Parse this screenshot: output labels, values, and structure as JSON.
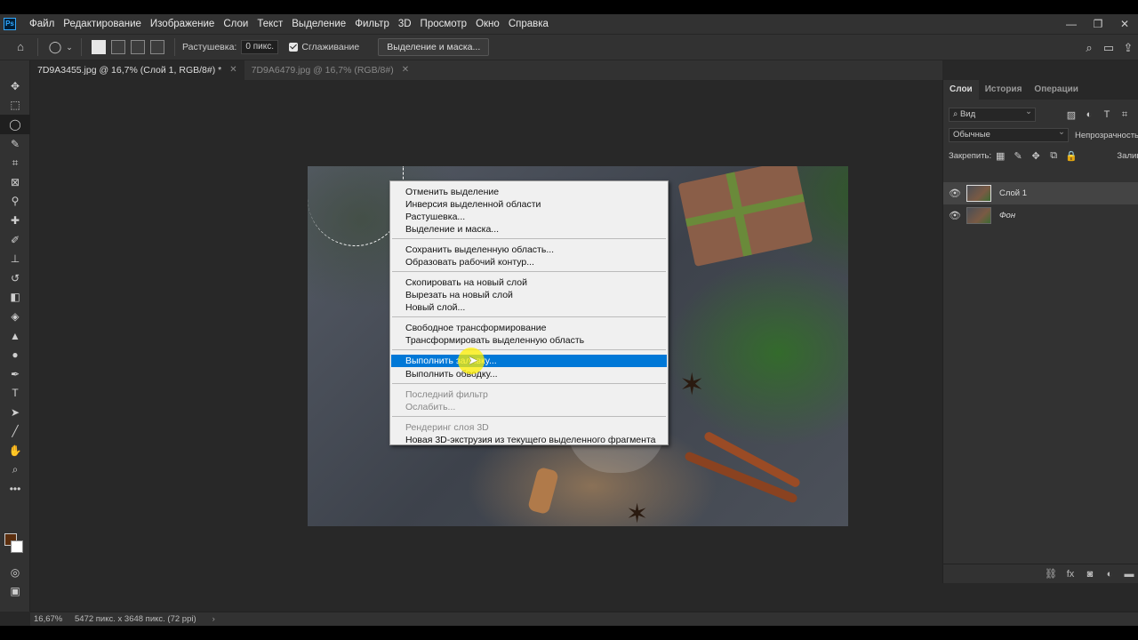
{
  "app": {
    "logo": "Ps"
  },
  "menu": [
    "Файл",
    "Редактирование",
    "Изображение",
    "Слои",
    "Текст",
    "Выделение",
    "Фильтр",
    "3D",
    "Просмотр",
    "Окно",
    "Справка"
  ],
  "window_controls": {
    "minimize": "—",
    "restore": "❐",
    "close": "✕"
  },
  "options": {
    "feather_label": "Растушевка:",
    "feather_value": "0 пикс.",
    "antialias_label": "Сглаживание",
    "select_mask_label": "Выделение и маска..."
  },
  "tabs": [
    {
      "label": "7D9A3455.jpg @ 16,7% (Слой 1, RGB/8#) *",
      "active": true
    },
    {
      "label": "7D9A6479.jpg @ 16,7% (RGB/8#)",
      "active": false
    }
  ],
  "context_menu": {
    "items": [
      {
        "label": "Отменить выделение",
        "state": "normal"
      },
      {
        "label": "Инверсия выделенной области",
        "state": "normal"
      },
      {
        "label": "Растушевка...",
        "state": "normal"
      },
      {
        "label": "Выделение и маска...",
        "state": "normal"
      },
      {
        "label": "Сохранить выделенную область...",
        "state": "normal"
      },
      {
        "label": "Образовать рабочий контур...",
        "state": "normal"
      },
      {
        "label": "Скопировать на новый слой",
        "state": "normal"
      },
      {
        "label": "Вырезать на новый слой",
        "state": "normal"
      },
      {
        "label": "Новый слой...",
        "state": "normal"
      },
      {
        "label": "Свободное трансформирование",
        "state": "normal"
      },
      {
        "label": "Трансформировать выделенную область",
        "state": "normal"
      },
      {
        "label": "Выполнить заливку...",
        "state": "highlighted"
      },
      {
        "label": "Выполнить обводку...",
        "state": "normal"
      },
      {
        "label": "Последний фильтр",
        "state": "disabled"
      },
      {
        "label": "Ослабить...",
        "state": "disabled"
      },
      {
        "label": "Рендеринг слоя 3D",
        "state": "disabled"
      },
      {
        "label": "Новая 3D-экструзия из текущего выделенного фрагмента",
        "state": "normal"
      }
    ]
  },
  "layers_panel": {
    "tabs": [
      "Слои",
      "История",
      "Операции"
    ],
    "filter_label": "Вид",
    "blend_mode": "Обычные",
    "opacity_label": "Непрозрачность",
    "lock_label": "Закрепить:",
    "fill_label": "Заливка",
    "layers": [
      {
        "name": "Слой 1",
        "selected": true
      },
      {
        "name": "Фон",
        "selected": false
      }
    ]
  },
  "status": {
    "zoom": "16,67%",
    "doc_info": "5472 пикс. x 3648 пикс. (72 ppi)",
    "arrow": "›"
  },
  "colors": {
    "accent": "#0078d7",
    "foreground_swatch": "#5b2e0e",
    "background_swatch": "#ffffff"
  }
}
